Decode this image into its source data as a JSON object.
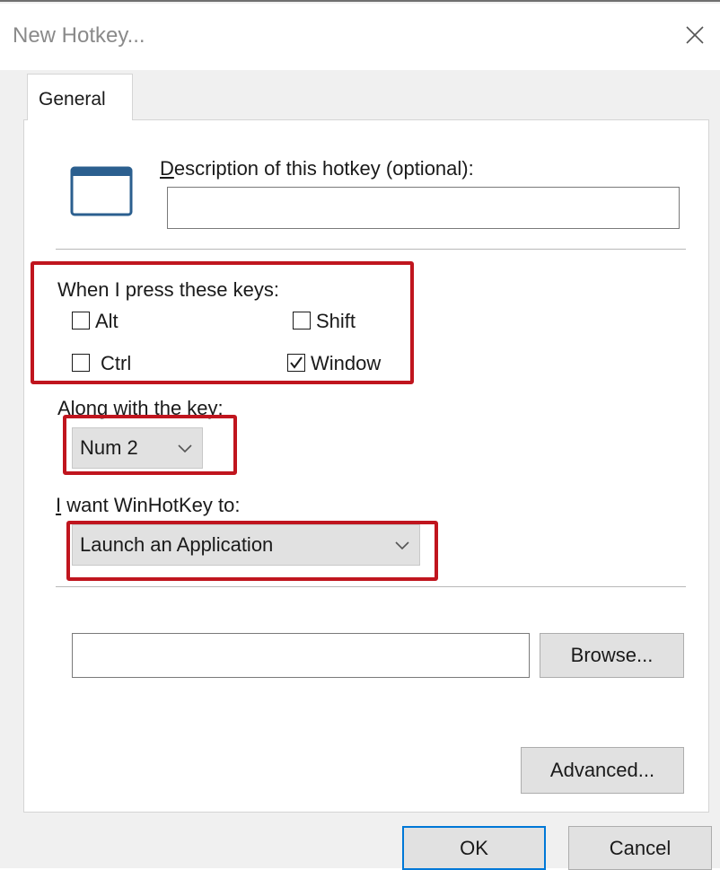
{
  "window": {
    "title": "New Hotkey...",
    "close_icon": "close-icon"
  },
  "tabs": [
    {
      "label": "General",
      "selected": true
    }
  ],
  "description": {
    "label": "Description of this hotkey (optional):",
    "value": "",
    "icon": "window-frame-icon"
  },
  "keys": {
    "label": "When I press these keys:",
    "modifiers": {
      "alt": {
        "label": "Alt",
        "checked": false
      },
      "shift": {
        "label": "Shift",
        "checked": false
      },
      "ctrl": {
        "label": "Ctrl",
        "checked": false
      },
      "window": {
        "label": "Window",
        "checked": true
      }
    }
  },
  "along_with": {
    "label": "Along with the key:",
    "selected": "Num 2"
  },
  "action": {
    "label": "I want WinHotKey to:",
    "selected": "Launch an Application"
  },
  "application": {
    "path_value": "",
    "browse_label": "Browse..."
  },
  "advanced_label": "Advanced...",
  "footer": {
    "ok_label": "OK",
    "cancel_label": "Cancel"
  },
  "highlight_color": "#c0151e",
  "accent_color": "#0078d7"
}
